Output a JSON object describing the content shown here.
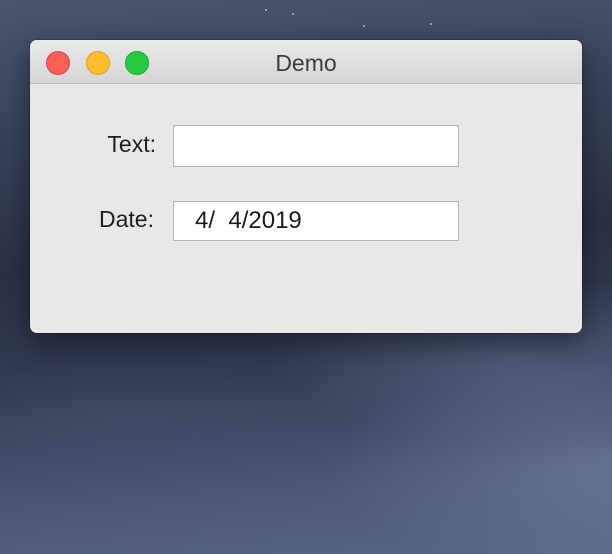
{
  "window": {
    "title": "Demo"
  },
  "form": {
    "text_label": "Text:",
    "text_value": "",
    "date_label": "Date:",
    "date_value": "4/  4/2019"
  },
  "colors": {
    "close": "#fc5f57",
    "minimize": "#fdbc2e",
    "maximize": "#28c840",
    "window_bg": "#e8e8e8"
  },
  "icons": {
    "close": "close-icon",
    "minimize": "minimize-icon",
    "maximize": "maximize-icon"
  }
}
